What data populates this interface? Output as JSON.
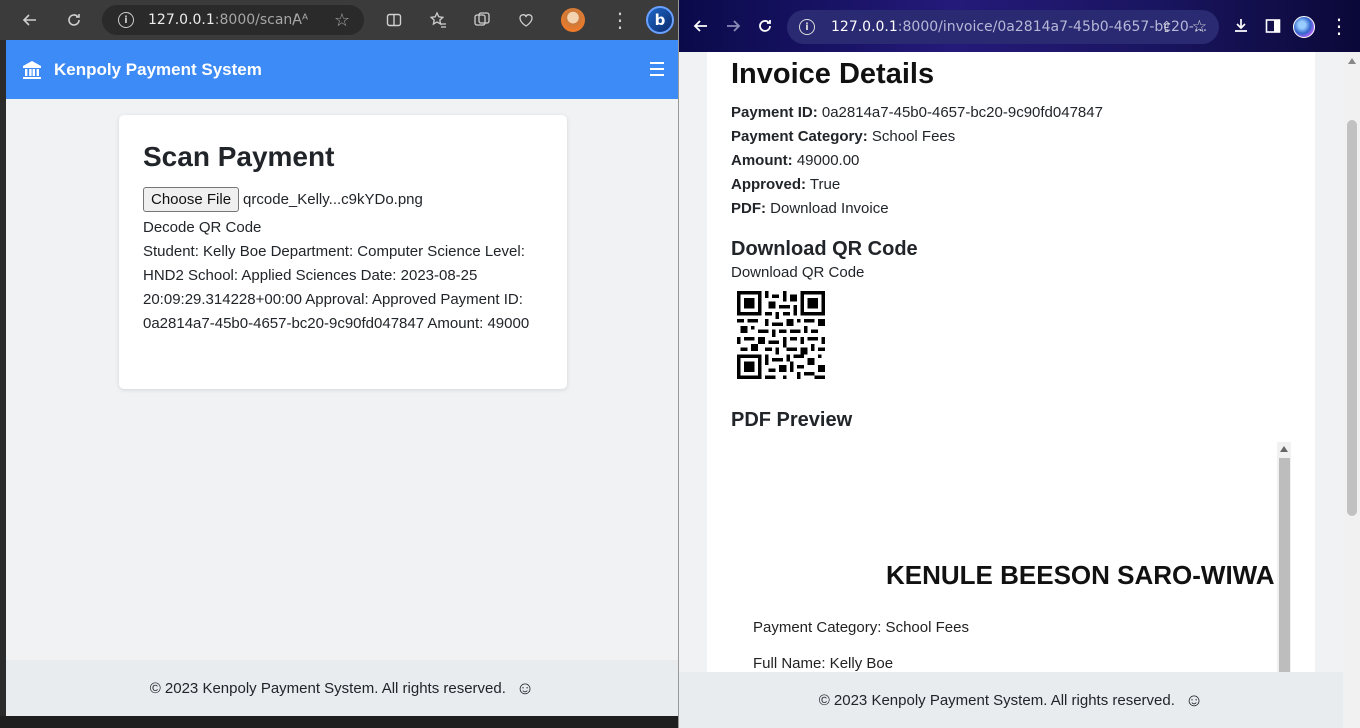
{
  "left_browser": {
    "url_host": "127.0.0.1",
    "url_rest": ":8000/scan/",
    "reader_icon": "Aᴬ",
    "bing_label": "b"
  },
  "left_app": {
    "brand": "Kenpoly Payment System",
    "title": "Scan Payment",
    "file_button": "Choose File",
    "file_name": "qrcode_Kelly...c9kYDo.png",
    "decode_label": "Decode QR Code",
    "decoded_text": "Student: Kelly Boe Department: Computer Science Level: HND2 School: Applied Sciences Date: 2023-08-25 20:09:29.314228+00:00 Approval: Approved Payment ID: 0a2814a7-45b0-4657-bc20-9c90fd047847 Amount: 49000",
    "footer": "© 2023 Kenpoly Payment System. All rights reserved.",
    "smiley": "☺"
  },
  "right_browser": {
    "url_host": "127.0.0.1",
    "url_rest": ":8000/invoice/0a2814a7-45b0-4657-bc20-..."
  },
  "invoice": {
    "title": "Invoice Details",
    "payment_id_label": "Payment ID:",
    "payment_id": "0a2814a7-45b0-4657-bc20-9c90fd047847",
    "category_label": "Payment Category:",
    "category": "School Fees",
    "amount_label": "Amount:",
    "amount": "49000.00",
    "approved_label": "Approved:",
    "approved": "True",
    "pdf_label": "PDF:",
    "pdf_link": "Download Invoice",
    "qr_heading": "Download QR Code",
    "qr_link": "Download QR Code",
    "pdf_heading": "PDF Preview",
    "pdf_doc_title": "KENULE BEESON SARO-WIWA",
    "pdf_category": "Payment Category: School Fees",
    "pdf_name": "Full Name: Kelly Boe",
    "footer": "© 2023 Kenpoly Payment System. All rights reserved.",
    "smiley": "☺"
  }
}
